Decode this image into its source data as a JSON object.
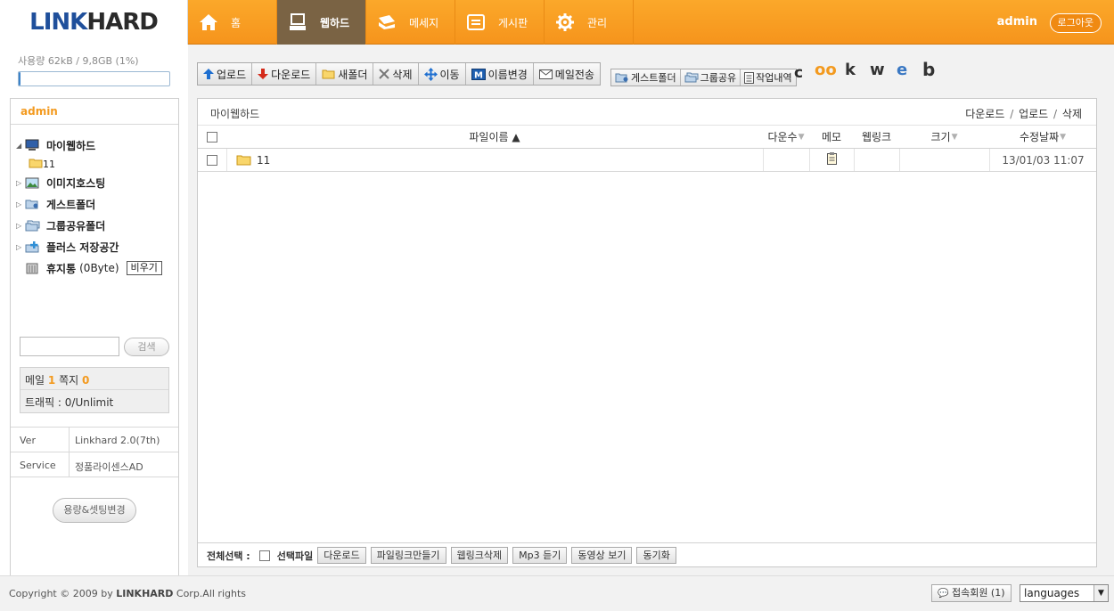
{
  "brand": {
    "logo_main": "LINK",
    "logo_ink": "HARD"
  },
  "colors": {
    "accent": "#f6941c",
    "active_tab": "#7a6344",
    "link_blue": "#1f4f9b",
    "highlight": "#f39a1f"
  },
  "nav": [
    {
      "label": "홈",
      "icon": "home-icon"
    },
    {
      "label": "웹하드",
      "icon": "computer-icon",
      "active": true
    },
    {
      "label": "메세지",
      "icon": "message-icon"
    },
    {
      "label": "게시판",
      "icon": "board-icon"
    },
    {
      "label": "관리",
      "icon": "gear-icon"
    }
  ],
  "header": {
    "user": "admin",
    "logout": "로그아웃"
  },
  "sidebar": {
    "usage_text": "사용량 62kB / 9,8GB (1%)",
    "usage_fraction": 0.01,
    "user": "admin",
    "tree": [
      {
        "label": "마이웹하드",
        "icon": "monitor-icon"
      },
      {
        "label": "11",
        "icon": "folder-icon"
      },
      {
        "label": "이미지호스팅",
        "icon": "image-icon"
      },
      {
        "label": "게스트폴더",
        "icon": "guest-folder-icon"
      },
      {
        "label": "그룹공유폴더",
        "icon": "group-folder-icon"
      },
      {
        "label": "플러스 저장공간",
        "icon": "plus-storage-icon"
      },
      {
        "label": "휴지통",
        "size": "(0Byte)",
        "empty_label": "비우기",
        "icon": "trash-icon"
      }
    ],
    "search_button": "검색",
    "mail_label": "메일",
    "mail_count": "1",
    "note_label": "쪽지",
    "note_count": "0",
    "traffic": "트래픽 : 0/Unlimit",
    "version_key": "Ver",
    "version_val": "Linkhard 2.0(7th)",
    "service_key": "Service",
    "service_val": "정품라이센스AD",
    "change_button": "용량&셋팅변경"
  },
  "toolbar": {
    "buttons": [
      {
        "label": "업로드",
        "icon": "upload-icon"
      },
      {
        "label": "다운로드",
        "icon": "download-icon"
      },
      {
        "label": "새폴더",
        "icon": "new-folder-icon"
      },
      {
        "label": "삭제",
        "icon": "delete-icon"
      },
      {
        "label": "이동",
        "icon": "move-icon"
      },
      {
        "label": "이름변경",
        "icon": "rename-icon"
      },
      {
        "label": "메일전송",
        "icon": "mail-icon"
      }
    ],
    "buttons2": [
      {
        "label": "게스트폴더",
        "icon": "guest-folder-icon"
      },
      {
        "label": "그룹공유",
        "icon": "group-share-icon"
      },
      {
        "label": "작업내역",
        "icon": "history-icon"
      }
    ],
    "c_letter": "c",
    "social": [
      {
        "label": "oo",
        "color": "#f39a1f",
        "icon": "orkut-icon"
      },
      {
        "label": "k",
        "color": "#333333",
        "icon": "k-icon"
      },
      {
        "label": "w",
        "color": "#333333",
        "icon": "w-icon"
      },
      {
        "label": "e",
        "color": "#3a78c3",
        "icon": "e-icon"
      },
      {
        "label": "b",
        "color": "#333333",
        "icon": "b-icon"
      }
    ]
  },
  "filebox": {
    "path": "마이웹하드",
    "actions": [
      "다운로드",
      "업로드",
      "삭제"
    ],
    "action_sep": "/",
    "columns": {
      "name": "파일이름 ▲",
      "downloads": "다운수",
      "memo": "메모",
      "weblink": "웹링크",
      "size": "크기",
      "modified": "수정날짜"
    },
    "rows": [
      {
        "name": "11",
        "downloads": "",
        "memo": "memo-icon",
        "weblink": "",
        "size": "",
        "modified": "13/01/03 11:07"
      }
    ]
  },
  "bottombar": {
    "select_all": "전체선택 :",
    "selected_label": "선택파일",
    "buttons": [
      "다운로드",
      "파일링크만들기",
      "웹링크삭제",
      "Mp3 듣기",
      "동영상 보기",
      "동기화"
    ]
  },
  "footer": {
    "copyright_pre": "Copyright © 2009 by",
    "copyright_brand": "LINKHARD",
    "copyright_post": "Corp.All rights",
    "members": "접속회원 (1)",
    "language": "languages"
  }
}
